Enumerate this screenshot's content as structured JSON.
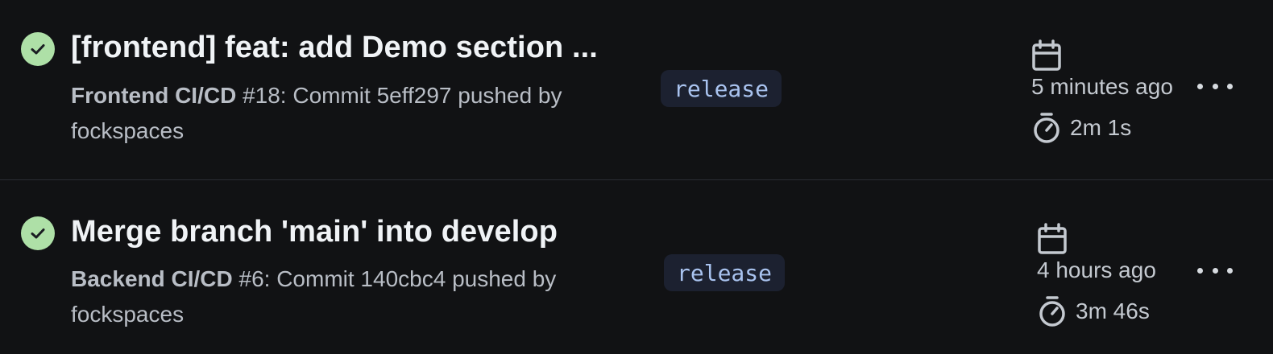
{
  "runs": [
    {
      "title": "[frontend] feat: add Demo section ...",
      "workflow": "Frontend CI/CD",
      "details": " #18: Commit 5eff297 pushed by fockspaces",
      "branch": "release",
      "when": "5 minutes ago",
      "duration": "2m 1s"
    },
    {
      "title": "Merge branch 'main' into develop",
      "workflow": "Backend CI/CD",
      "details": " #6: Commit 140cbc4 pushed by fockspaces",
      "branch": "release",
      "when": "4 hours ago",
      "duration": "3m 46s"
    }
  ],
  "icons": {
    "status": "check-circle-icon",
    "calendar": "calendar-icon",
    "duration": "stopwatch-icon",
    "menu": "kebab-menu-icon"
  },
  "colors": {
    "success": "#aee0a7",
    "branch_bg": "#1c2130",
    "branch_text": "#a9c3ef"
  }
}
